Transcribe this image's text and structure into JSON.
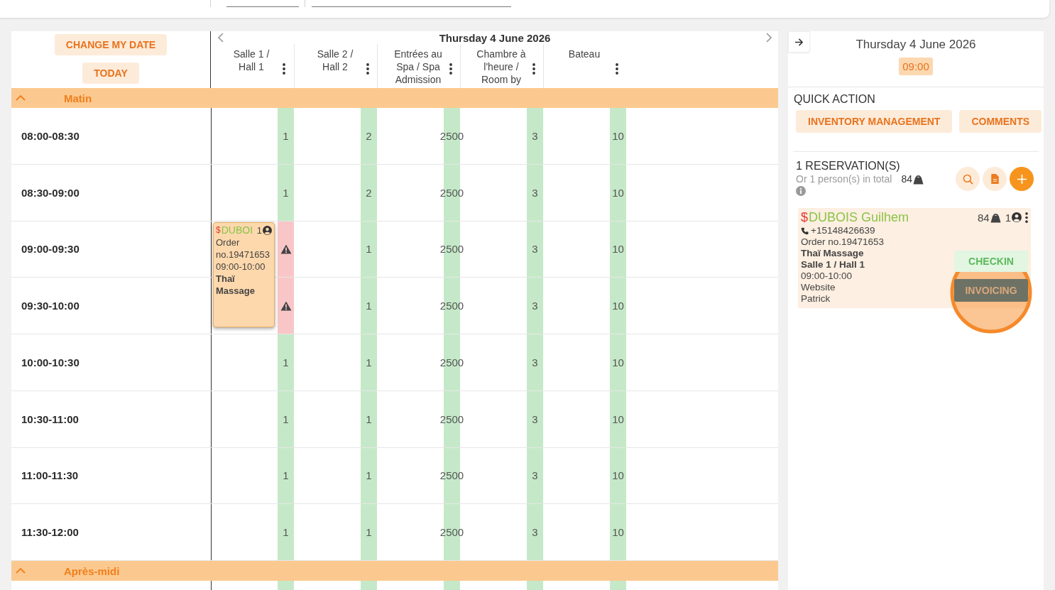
{
  "calendar": {
    "buttons": [
      "CHANGE MY DATE",
      "TODAY"
    ],
    "date_title": "Thursday 4 June 2026",
    "resources": [
      {
        "label": "Salle 1 / Hall 1"
      },
      {
        "label": "Salle 2 / Hall 2"
      },
      {
        "label": "Entrées au Spa / Spa Admission"
      },
      {
        "label": "Chambre à l'heure / Room by"
      },
      {
        "label": "Bateau"
      }
    ],
    "sections": [
      {
        "title": "Matin",
        "expanded": true,
        "rows": [
          {
            "time": "08:00-08:30",
            "cells": [
              {
                "value": "1",
                "conflict": false
              },
              {
                "value": "2",
                "conflict": false
              },
              {
                "value": "2500",
                "conflict": false
              },
              {
                "value": "3",
                "conflict": false
              },
              {
                "value": "10",
                "conflict": false
              }
            ]
          },
          {
            "time": "08:30-09:00",
            "cells": [
              {
                "value": "1",
                "conflict": false
              },
              {
                "value": "2",
                "conflict": false
              },
              {
                "value": "2500",
                "conflict": false
              },
              {
                "value": "3",
                "conflict": false
              },
              {
                "value": "10",
                "conflict": false
              }
            ]
          },
          {
            "time": "09:00-09:30",
            "cells": [
              {
                "conflict": true,
                "booking": {
                  "price_mark": "$",
                  "name": "DUBOI",
                  "persons": "1",
                  "order": "Order no.19471653",
                  "time": "09:00-10:00",
                  "service": "Thaï Massage"
                }
              },
              {
                "value": "1",
                "conflict": false
              },
              {
                "value": "2500",
                "conflict": false
              },
              {
                "value": "3",
                "conflict": false
              },
              {
                "value": "10",
                "conflict": false
              }
            ]
          },
          {
            "time": "09:30-10:00",
            "cells": [
              {
                "conflict": true
              },
              {
                "value": "1",
                "conflict": false
              },
              {
                "value": "2500",
                "conflict": false
              },
              {
                "value": "3",
                "conflict": false
              },
              {
                "value": "10",
                "conflict": false
              }
            ]
          },
          {
            "time": "10:00-10:30",
            "cells": [
              {
                "value": "1",
                "conflict": false
              },
              {
                "value": "1",
                "conflict": false
              },
              {
                "value": "2500",
                "conflict": false
              },
              {
                "value": "3",
                "conflict": false
              },
              {
                "value": "10",
                "conflict": false
              }
            ]
          },
          {
            "time": "10:30-11:00",
            "cells": [
              {
                "value": "1",
                "conflict": false
              },
              {
                "value": "1",
                "conflict": false
              },
              {
                "value": "2500",
                "conflict": false
              },
              {
                "value": "3",
                "conflict": false
              },
              {
                "value": "10",
                "conflict": false
              }
            ]
          },
          {
            "time": "11:00-11:30",
            "cells": [
              {
                "value": "1",
                "conflict": false
              },
              {
                "value": "1",
                "conflict": false
              },
              {
                "value": "2500",
                "conflict": false
              },
              {
                "value": "3",
                "conflict": false
              },
              {
                "value": "10",
                "conflict": false
              }
            ]
          },
          {
            "time": "11:30-12:00",
            "cells": [
              {
                "value": "1",
                "conflict": false
              },
              {
                "value": "1",
                "conflict": false
              },
              {
                "value": "2500",
                "conflict": false
              },
              {
                "value": "3",
                "conflict": false
              },
              {
                "value": "10",
                "conflict": false
              }
            ]
          }
        ]
      },
      {
        "title": "Après-midi",
        "expanded": true,
        "rows": [
          {
            "cells": [
              {
                "conflict": false
              },
              {
                "conflict": false
              },
              {
                "conflict": false
              },
              {
                "conflict": false
              },
              {
                "conflict": false
              }
            ]
          }
        ]
      }
    ]
  },
  "side_panel": {
    "date": "Thursday 4 June 2026",
    "time": "09:00",
    "quick_action": {
      "title": "QUICK ACTION",
      "buttons": [
        "INVENTORY MANAGEMENT",
        "COMMENTS"
      ]
    },
    "reservations": {
      "title": "1 RESERVATION(S)",
      "subtitle": "Or 1 person(s) in total",
      "count": "84",
      "items": [
        {
          "price_mark": "$",
          "name": "DUBOIS Guilhem",
          "count": "84",
          "persons": "1",
          "phone": "+15148426639",
          "order": "Order no.19471653",
          "service": "Thaï Massage",
          "room": "Salle 1 / Hall 1",
          "time": "09:00-10:00",
          "source": "Website",
          "staff": "Patrick",
          "actions": [
            {
              "label": "CHECKIN",
              "kind": "checkin",
              "highlighted": false
            },
            {
              "label": "INVOICING",
              "kind": "invoice",
              "highlighted": true
            }
          ]
        }
      ]
    }
  }
}
